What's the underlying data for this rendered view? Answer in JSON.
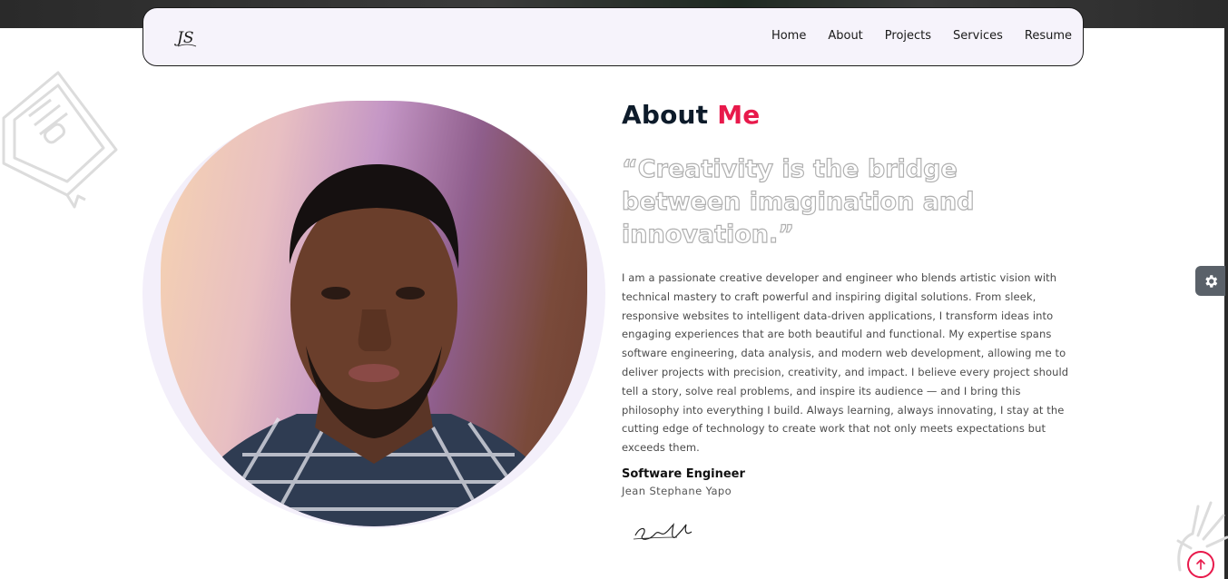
{
  "nav": {
    "logo_text": "JS",
    "links": [
      "Home",
      "About",
      "Projects",
      "Services",
      "Resume"
    ]
  },
  "about": {
    "title_main": "About",
    "title_accent": "Me",
    "quote": "“Creativity is the bridge between imagination and innovation.”",
    "bio": "I am a passionate creative developer and engineer who blends artistic vision with technical mastery to craft powerful and inspiring digital solutions. From sleek, responsive websites to intelligent data-driven applications, I transform ideas into engaging experiences that are both beautiful and functional. My expertise spans software engineering, data analysis, and modern web development, allowing me to deliver projects with precision, creativity, and impact. I believe every project should tell a story, solve real problems, and inspire its audience — and I bring this philosophy into everything I build. Always learning, always innovating, I stay at the cutting edge of technology to create work that not only meets expectations but exceeds them.",
    "role": "Software Engineer",
    "name": "Jean Stephane Yapo",
    "signature_text": "Stephane Yapo"
  },
  "colors": {
    "accent": "#e8194b",
    "heading": "#0d1b2a",
    "nav_bg": "#f6f3fb"
  },
  "icons": {
    "settings": "gear-icon",
    "scroll_top": "arrow-up-icon"
  }
}
